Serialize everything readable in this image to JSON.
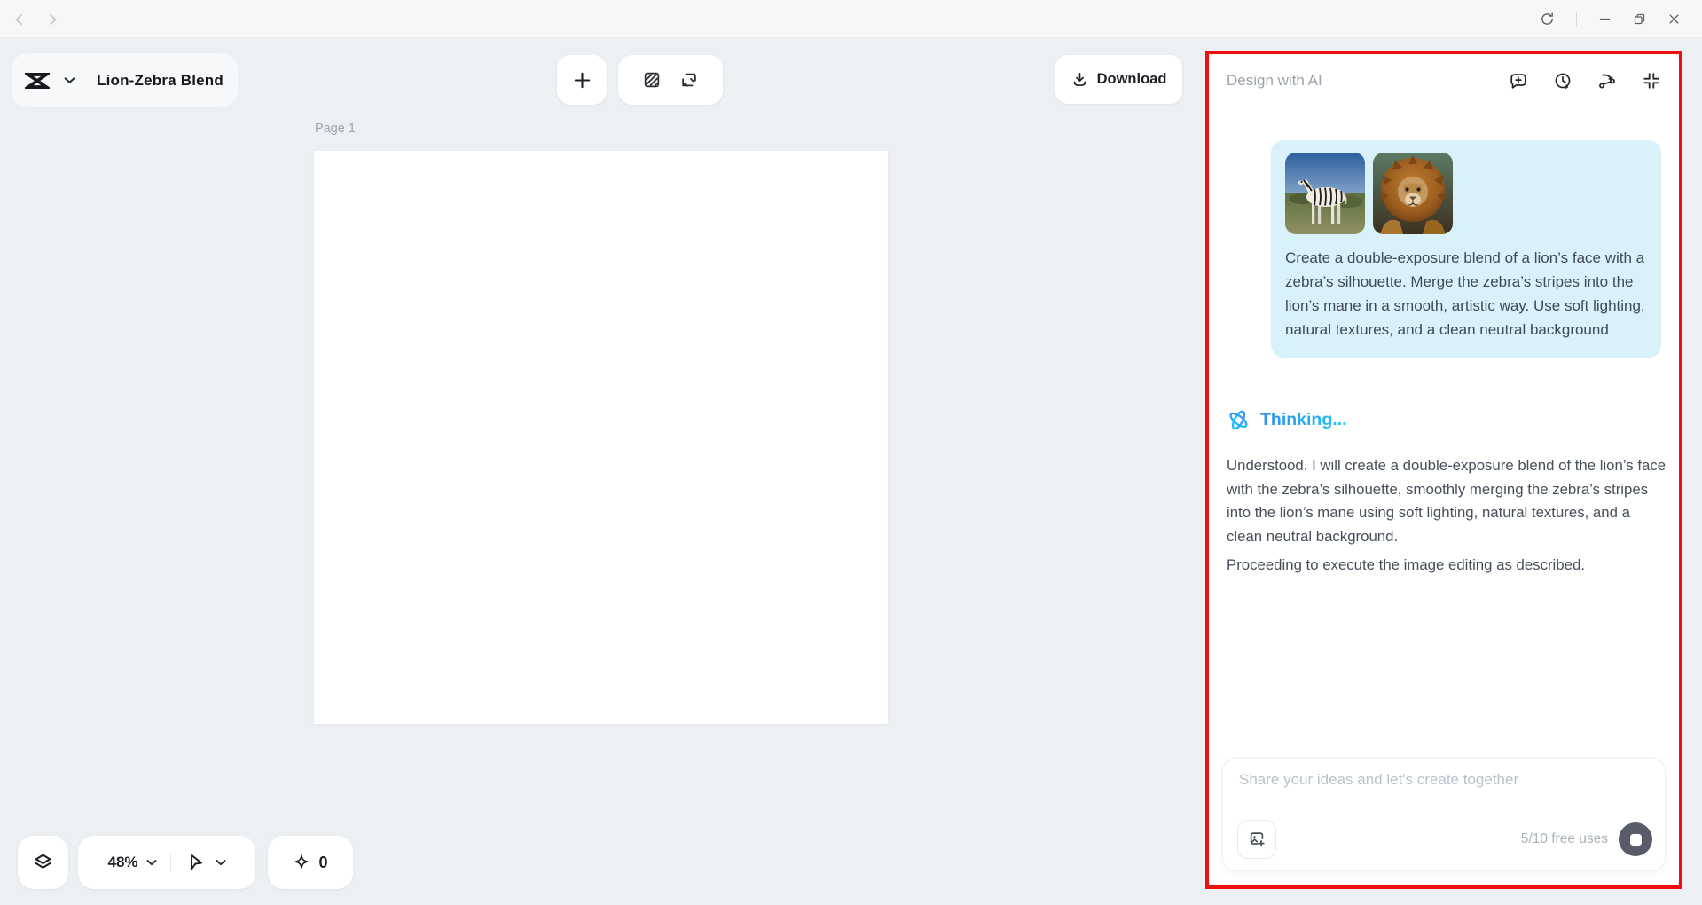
{
  "window": {
    "controls": {
      "reload": "reload",
      "minimize": "minimize",
      "restore": "restore",
      "close": "close"
    }
  },
  "topbar": {
    "doc_title": "Lion-Zebra Blend",
    "download_label": "Download"
  },
  "canvas": {
    "page_label": "Page 1"
  },
  "bottom_toolbar": {
    "zoom_level": "48%",
    "credits_count": "0"
  },
  "ai_panel": {
    "title": "Design with AI",
    "user_message": {
      "text": "Create a double-exposure blend of a lion’s face with a zebra’s silhouette. Merge the zebra’s stripes into the lion’s mane in a smooth, artistic way. Use soft lighting, natural textures, and a clean neutral background",
      "attachments": [
        "zebra-photo",
        "lion-photo"
      ]
    },
    "status_label": "Thinking...",
    "response": {
      "p1": "Understood. I will create a double-exposure blend of the lion’s face with the zebra’s silhouette, smoothly merging the zebra’s stripes into the lion’s mane using soft lighting, natural textures, and a clean neutral background.",
      "p2": "Proceeding to execute the image editing as described."
    },
    "input": {
      "placeholder": "Share your ideas and let's create together",
      "usage": "5/10 free uses"
    }
  },
  "colors": {
    "accent_cyan": "#15c9f2",
    "accent_blue": "#2f8ef0",
    "bubble_bg": "#d9f1f8",
    "annotation_red": "#ee0f0f",
    "panel_bg": "#ffffff",
    "app_bg": "#edf0f3",
    "stop_button": "#575c68"
  }
}
